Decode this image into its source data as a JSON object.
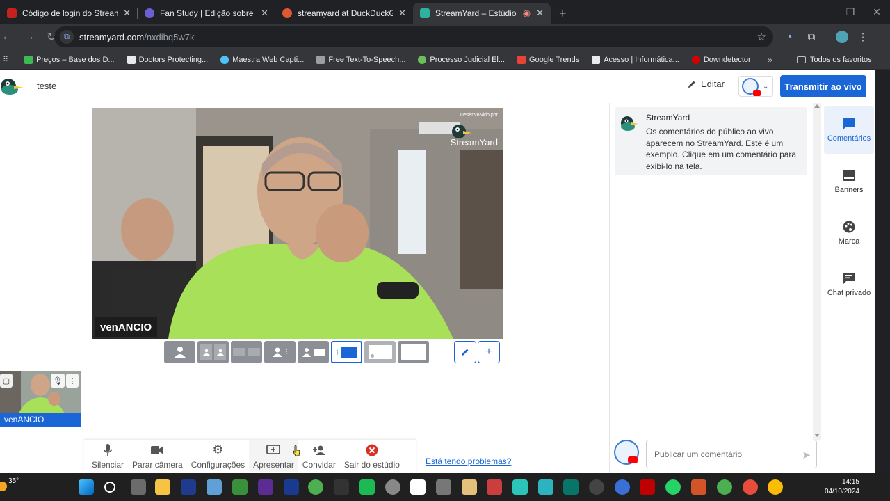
{
  "browser": {
    "tabs": [
      {
        "title": "Código de login do StreamYard",
        "favicon_color": "#c5221f",
        "active": false
      },
      {
        "title": "Fan Study | Edição sobre podca...",
        "favicon_color": "#6b5fd3",
        "active": false
      },
      {
        "title": "streamyard at DuckDuckGo",
        "favicon_color": "#de5833",
        "active": false
      },
      {
        "title": "StreamYard – Estúdio",
        "favicon_color": "#2bb3a0",
        "active": true
      }
    ],
    "url_host": "streamyard.com",
    "url_path": "/nxdibq5w7k",
    "bookmarks": [
      {
        "label": "Preços – Base dos D...",
        "color": "#3cba54"
      },
      {
        "label": "Doctors Protecting...",
        "color": "#e8eaed"
      },
      {
        "label": "Maestra Web Capti...",
        "color": "#4fc3f7"
      },
      {
        "label": "Free Text-To-Speech...",
        "color": "#9e9e9e"
      },
      {
        "label": "Processo Judicial El...",
        "color": "#6bbf59"
      },
      {
        "label": "Google Trends",
        "color": "#ea4335"
      },
      {
        "label": "Acesso | Informática...",
        "color": "#e8eaed"
      },
      {
        "label": "Downdetector",
        "color": "#d50000"
      }
    ],
    "bookmarks_folder": "Todos os favoritos"
  },
  "header": {
    "broadcast_name": "teste",
    "edit_label": "Editar",
    "go_live_label": "Transmitir ao vivo"
  },
  "stage": {
    "participant_name": "venANCIO",
    "watermark_small": "Desenvolvido por",
    "watermark_brand": "StreamYard"
  },
  "thumbnail": {
    "participant_name": "venANCIO"
  },
  "controls": [
    {
      "label": "Silenciar",
      "icon": "mic-icon"
    },
    {
      "label": "Parar câmera",
      "icon": "camera-icon"
    },
    {
      "label": "Configurações",
      "icon": "gear-icon"
    },
    {
      "label": "Apresentar",
      "icon": "present-icon"
    },
    {
      "label": "Convidar",
      "icon": "add-person-icon"
    },
    {
      "label": "Sair do estúdio",
      "icon": "exit-icon"
    }
  ],
  "problems_link": "Está tendo problemas?",
  "comments": {
    "author": "StreamYard",
    "text": "Os comentários do público ao vivo aparecem no StreamYard. Este é um exemplo. Clique em um comentário para exibi-lo na tela.",
    "input_placeholder": "Publicar um comentário"
  },
  "sidenav": [
    {
      "label": "Comentários",
      "active": true
    },
    {
      "label": "Banners",
      "active": false
    },
    {
      "label": "Marca",
      "active": false
    },
    {
      "label": "Chat privado",
      "active": false
    }
  ],
  "taskbar": {
    "temperature": "35°",
    "time": "14:15",
    "date": "04/10/2024"
  },
  "colors": {
    "accent": "#1a66d6",
    "browser_dark": "#202124",
    "exit_red": "#d93025"
  }
}
